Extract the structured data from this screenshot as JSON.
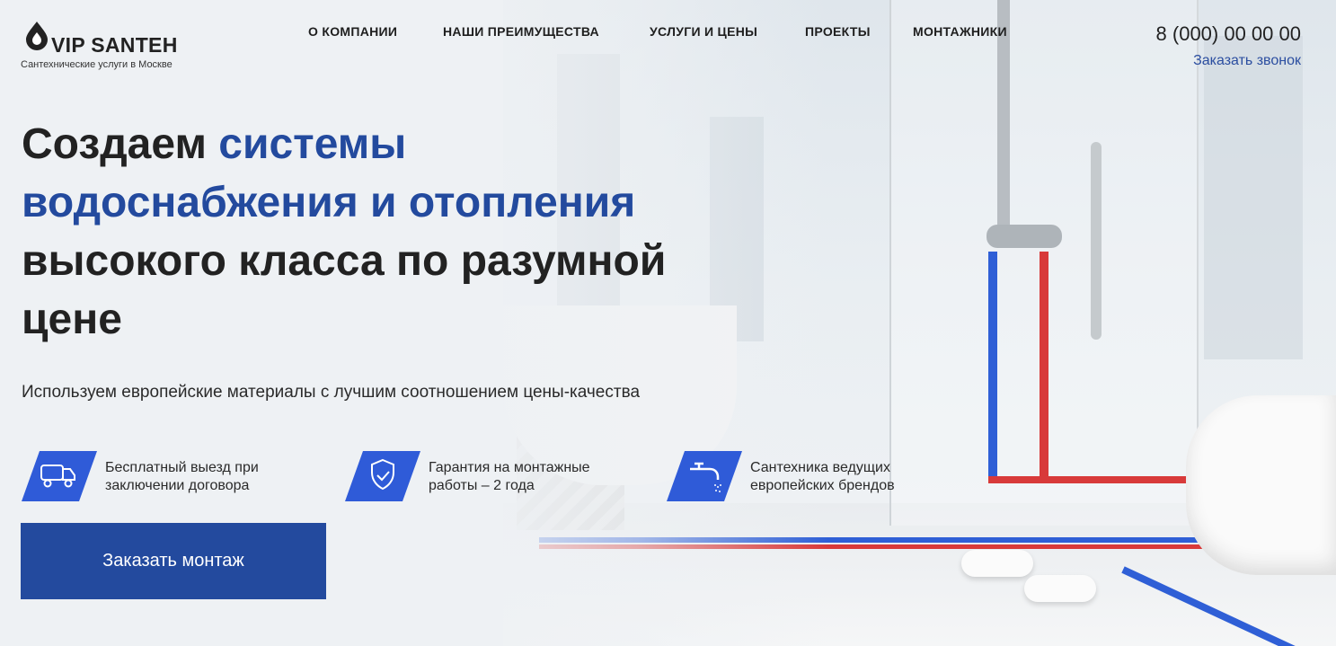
{
  "brand": {
    "name": "VIP SANTEH",
    "tagline": "Сантехнические услуги в Москве"
  },
  "nav": {
    "items": [
      "О КОМПАНИИ",
      "НАШИ ПРЕИМУЩЕСТВА",
      "УСЛУГИ И ЦЕНЫ",
      "ПРОЕКТЫ",
      "МОНТАЖНИКИ"
    ]
  },
  "contact": {
    "phone": "8 (000) 00 00 00",
    "callback_label": "Заказать звонок"
  },
  "hero": {
    "title_part1": "Создаем ",
    "title_accent": "системы водоснабжения и отопления",
    "title_part2": " высокого класса по разумной цене",
    "subtitle": "Используем европейские материалы с лучшим соотношением цены-качества"
  },
  "features": [
    {
      "icon": "delivery-van-icon",
      "line1": "Бесплатный выезд при",
      "line2": "заключении договора"
    },
    {
      "icon": "shield-check-icon",
      "line1": "Гарантия на монтажные",
      "line2": "работы – 2 года"
    },
    {
      "icon": "faucet-icon",
      "line1": "Сантехника ведущих",
      "line2": "европейских брендов"
    }
  ],
  "cta": {
    "label": "Заказать монтаж"
  },
  "colors": {
    "accent": "#234a9e",
    "feature_icon_bg": "#2f5bd8",
    "text": "#222222"
  }
}
